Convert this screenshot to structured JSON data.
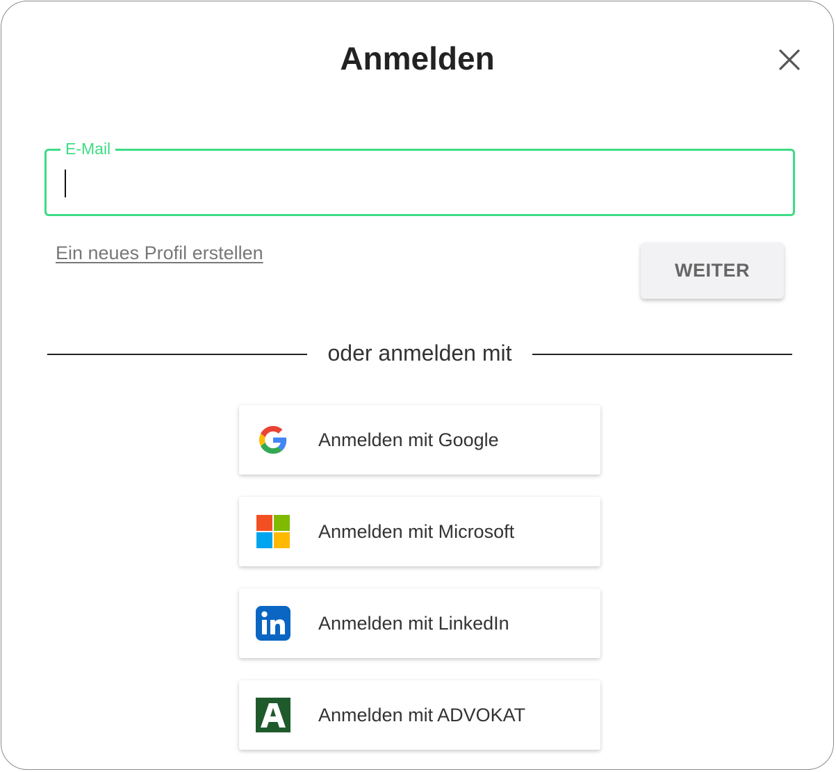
{
  "dialog": {
    "title": "Anmelden",
    "close_icon": "close-icon"
  },
  "email": {
    "label": "E-Mail",
    "value": "",
    "placeholder": ""
  },
  "create_profile_link": "Ein neues Profil erstellen",
  "next_button": "WEITER",
  "divider_text": "oder anmelden mit",
  "sso": [
    {
      "label": "Anmelden mit Google",
      "icon": "google-icon"
    },
    {
      "label": "Anmelden mit Microsoft",
      "icon": "microsoft-icon"
    },
    {
      "label": "Anmelden mit LinkedIn",
      "icon": "linkedin-icon"
    },
    {
      "label": "Anmelden mit ADVOKAT",
      "icon": "advokat-icon"
    }
  ],
  "colors": {
    "accent": "#3ddc84",
    "linkedin": "#0a66c2",
    "advokat": "#1f5a2c"
  }
}
